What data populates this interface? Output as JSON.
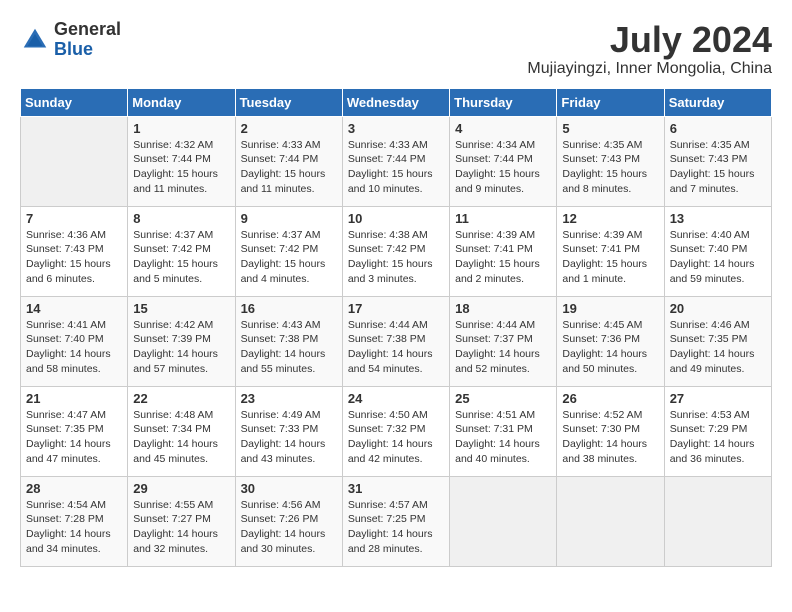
{
  "logo": {
    "general": "General",
    "blue": "Blue"
  },
  "title": {
    "month_year": "July 2024",
    "location": "Mujiayingzi, Inner Mongolia, China"
  },
  "weekdays": [
    "Sunday",
    "Monday",
    "Tuesday",
    "Wednesday",
    "Thursday",
    "Friday",
    "Saturday"
  ],
  "weeks": [
    [
      {
        "day": "",
        "sunrise": "",
        "sunset": "",
        "daylight": ""
      },
      {
        "day": "1",
        "sunrise": "Sunrise: 4:32 AM",
        "sunset": "Sunset: 7:44 PM",
        "daylight": "Daylight: 15 hours and 11 minutes."
      },
      {
        "day": "2",
        "sunrise": "Sunrise: 4:33 AM",
        "sunset": "Sunset: 7:44 PM",
        "daylight": "Daylight: 15 hours and 11 minutes."
      },
      {
        "day": "3",
        "sunrise": "Sunrise: 4:33 AM",
        "sunset": "Sunset: 7:44 PM",
        "daylight": "Daylight: 15 hours and 10 minutes."
      },
      {
        "day": "4",
        "sunrise": "Sunrise: 4:34 AM",
        "sunset": "Sunset: 7:44 PM",
        "daylight": "Daylight: 15 hours and 9 minutes."
      },
      {
        "day": "5",
        "sunrise": "Sunrise: 4:35 AM",
        "sunset": "Sunset: 7:43 PM",
        "daylight": "Daylight: 15 hours and 8 minutes."
      },
      {
        "day": "6",
        "sunrise": "Sunrise: 4:35 AM",
        "sunset": "Sunset: 7:43 PM",
        "daylight": "Daylight: 15 hours and 7 minutes."
      }
    ],
    [
      {
        "day": "7",
        "sunrise": "Sunrise: 4:36 AM",
        "sunset": "Sunset: 7:43 PM",
        "daylight": "Daylight: 15 hours and 6 minutes."
      },
      {
        "day": "8",
        "sunrise": "Sunrise: 4:37 AM",
        "sunset": "Sunset: 7:42 PM",
        "daylight": "Daylight: 15 hours and 5 minutes."
      },
      {
        "day": "9",
        "sunrise": "Sunrise: 4:37 AM",
        "sunset": "Sunset: 7:42 PM",
        "daylight": "Daylight: 15 hours and 4 minutes."
      },
      {
        "day": "10",
        "sunrise": "Sunrise: 4:38 AM",
        "sunset": "Sunset: 7:42 PM",
        "daylight": "Daylight: 15 hours and 3 minutes."
      },
      {
        "day": "11",
        "sunrise": "Sunrise: 4:39 AM",
        "sunset": "Sunset: 7:41 PM",
        "daylight": "Daylight: 15 hours and 2 minutes."
      },
      {
        "day": "12",
        "sunrise": "Sunrise: 4:39 AM",
        "sunset": "Sunset: 7:41 PM",
        "daylight": "Daylight: 15 hours and 1 minute."
      },
      {
        "day": "13",
        "sunrise": "Sunrise: 4:40 AM",
        "sunset": "Sunset: 7:40 PM",
        "daylight": "Daylight: 14 hours and 59 minutes."
      }
    ],
    [
      {
        "day": "14",
        "sunrise": "Sunrise: 4:41 AM",
        "sunset": "Sunset: 7:40 PM",
        "daylight": "Daylight: 14 hours and 58 minutes."
      },
      {
        "day": "15",
        "sunrise": "Sunrise: 4:42 AM",
        "sunset": "Sunset: 7:39 PM",
        "daylight": "Daylight: 14 hours and 57 minutes."
      },
      {
        "day": "16",
        "sunrise": "Sunrise: 4:43 AM",
        "sunset": "Sunset: 7:38 PM",
        "daylight": "Daylight: 14 hours and 55 minutes."
      },
      {
        "day": "17",
        "sunrise": "Sunrise: 4:44 AM",
        "sunset": "Sunset: 7:38 PM",
        "daylight": "Daylight: 14 hours and 54 minutes."
      },
      {
        "day": "18",
        "sunrise": "Sunrise: 4:44 AM",
        "sunset": "Sunset: 7:37 PM",
        "daylight": "Daylight: 14 hours and 52 minutes."
      },
      {
        "day": "19",
        "sunrise": "Sunrise: 4:45 AM",
        "sunset": "Sunset: 7:36 PM",
        "daylight": "Daylight: 14 hours and 50 minutes."
      },
      {
        "day": "20",
        "sunrise": "Sunrise: 4:46 AM",
        "sunset": "Sunset: 7:35 PM",
        "daylight": "Daylight: 14 hours and 49 minutes."
      }
    ],
    [
      {
        "day": "21",
        "sunrise": "Sunrise: 4:47 AM",
        "sunset": "Sunset: 7:35 PM",
        "daylight": "Daylight: 14 hours and 47 minutes."
      },
      {
        "day": "22",
        "sunrise": "Sunrise: 4:48 AM",
        "sunset": "Sunset: 7:34 PM",
        "daylight": "Daylight: 14 hours and 45 minutes."
      },
      {
        "day": "23",
        "sunrise": "Sunrise: 4:49 AM",
        "sunset": "Sunset: 7:33 PM",
        "daylight": "Daylight: 14 hours and 43 minutes."
      },
      {
        "day": "24",
        "sunrise": "Sunrise: 4:50 AM",
        "sunset": "Sunset: 7:32 PM",
        "daylight": "Daylight: 14 hours and 42 minutes."
      },
      {
        "day": "25",
        "sunrise": "Sunrise: 4:51 AM",
        "sunset": "Sunset: 7:31 PM",
        "daylight": "Daylight: 14 hours and 40 minutes."
      },
      {
        "day": "26",
        "sunrise": "Sunrise: 4:52 AM",
        "sunset": "Sunset: 7:30 PM",
        "daylight": "Daylight: 14 hours and 38 minutes."
      },
      {
        "day": "27",
        "sunrise": "Sunrise: 4:53 AM",
        "sunset": "Sunset: 7:29 PM",
        "daylight": "Daylight: 14 hours and 36 minutes."
      }
    ],
    [
      {
        "day": "28",
        "sunrise": "Sunrise: 4:54 AM",
        "sunset": "Sunset: 7:28 PM",
        "daylight": "Daylight: 14 hours and 34 minutes."
      },
      {
        "day": "29",
        "sunrise": "Sunrise: 4:55 AM",
        "sunset": "Sunset: 7:27 PM",
        "daylight": "Daylight: 14 hours and 32 minutes."
      },
      {
        "day": "30",
        "sunrise": "Sunrise: 4:56 AM",
        "sunset": "Sunset: 7:26 PM",
        "daylight": "Daylight: 14 hours and 30 minutes."
      },
      {
        "day": "31",
        "sunrise": "Sunrise: 4:57 AM",
        "sunset": "Sunset: 7:25 PM",
        "daylight": "Daylight: 14 hours and 28 minutes."
      },
      {
        "day": "",
        "sunrise": "",
        "sunset": "",
        "daylight": ""
      },
      {
        "day": "",
        "sunrise": "",
        "sunset": "",
        "daylight": ""
      },
      {
        "day": "",
        "sunrise": "",
        "sunset": "",
        "daylight": ""
      }
    ]
  ]
}
